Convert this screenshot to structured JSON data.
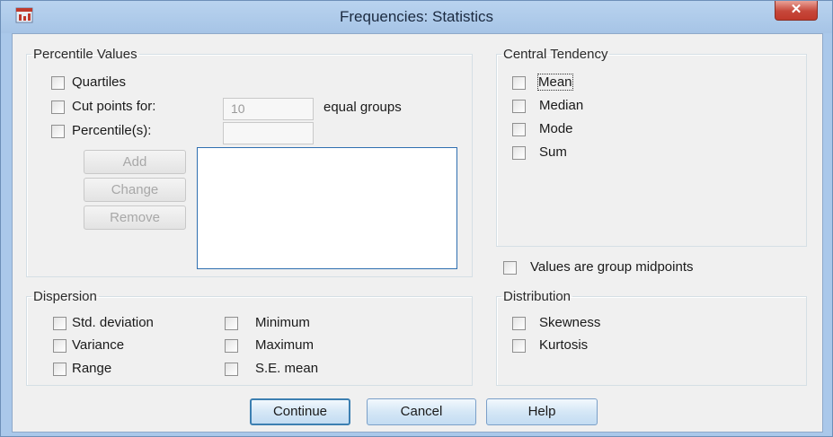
{
  "window": {
    "title": "Frequencies: Statistics",
    "close_label": "✕"
  },
  "percentile_values": {
    "label": "Percentile Values",
    "quartiles": "Quartiles",
    "cut_points": "Cut points for:",
    "cut_points_value": "10",
    "equal_groups": "equal groups",
    "percentiles": "Percentile(s):",
    "add": "Add",
    "change": "Change",
    "remove": "Remove"
  },
  "central_tendency": {
    "label": "Central Tendency",
    "items": [
      "Mean",
      "Median",
      "Mode",
      "Sum"
    ]
  },
  "group_midpoints": "Values are group midpoints",
  "dispersion": {
    "label": "Dispersion",
    "std_deviation": "Std. deviation",
    "variance": "Variance",
    "range": "Range",
    "minimum": "Minimum",
    "maximum": "Maximum",
    "se_mean": "S.E. mean"
  },
  "distribution": {
    "label": "Distribution",
    "skewness": "Skewness",
    "kurtosis": "Kurtosis"
  },
  "buttons": {
    "continue": "Continue",
    "cancel": "Cancel",
    "help": "Help"
  },
  "checkboxes_checked": {
    "quartiles": false,
    "cut_points": false,
    "percentiles": false,
    "mean": false,
    "median": false,
    "mode": false,
    "sum": false,
    "group_midpoints": false,
    "std_deviation": false,
    "variance": false,
    "range": false,
    "minimum": false,
    "maximum": false,
    "se_mean": false,
    "skewness": false,
    "kurtosis": false
  },
  "colors": {
    "window_frame": "#aac8ea",
    "client_bg": "#f0f0f0",
    "close_button": "#c6473a",
    "listbox_border": "#2f6fb0"
  }
}
